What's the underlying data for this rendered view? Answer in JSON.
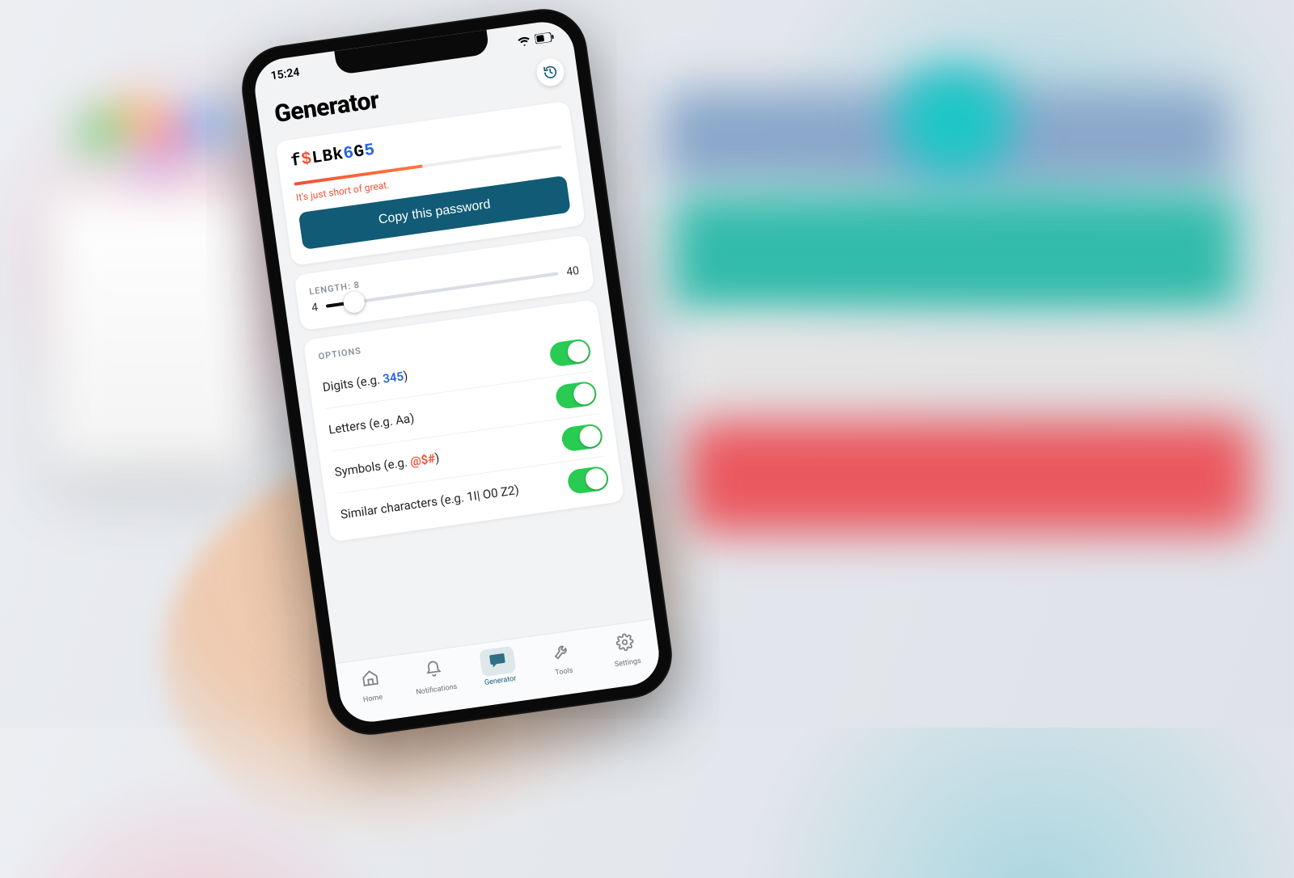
{
  "status": {
    "time": "15:24"
  },
  "page": {
    "title": "Generator"
  },
  "password": {
    "parts": [
      {
        "text": "f",
        "cls": ""
      },
      {
        "text": "$",
        "cls": "sym"
      },
      {
        "text": "LBk",
        "cls": ""
      },
      {
        "text": "6",
        "cls": "num"
      },
      {
        "text": "G",
        "cls": ""
      },
      {
        "text": "5",
        "cls": "num"
      }
    ],
    "strength_percent": 48,
    "strength_text": "It's just short of great.",
    "copy_label": "Copy this password"
  },
  "length": {
    "label": "LENGTH: 8",
    "min": "4",
    "max": "40",
    "value": 8,
    "percent": 12
  },
  "options": {
    "header": "OPTIONS",
    "items": [
      {
        "label": "Digits (e.g. ",
        "example": "345",
        "ex_class": "ex-num",
        "tail": ")",
        "on": true,
        "name": "digits"
      },
      {
        "label": "Letters (e.g. ",
        "example": "Aa",
        "ex_class": "",
        "tail": ")",
        "on": true,
        "name": "letters"
      },
      {
        "label": "Symbols (e.g. ",
        "example": "@$#",
        "ex_class": "ex-sym",
        "tail": ")",
        "on": true,
        "name": "symbols"
      },
      {
        "label": "Similar characters (e.g. ",
        "example": "1I| O0 Z2",
        "ex_class": "",
        "tail": ")",
        "on": true,
        "name": "similar"
      }
    ]
  },
  "tabs": [
    {
      "label": "Home",
      "icon": "home",
      "active": false
    },
    {
      "label": "Notifications",
      "icon": "bell",
      "active": false
    },
    {
      "label": "Generator",
      "icon": "chat",
      "active": true
    },
    {
      "label": "Tools",
      "icon": "wrench",
      "active": false
    },
    {
      "label": "Settings",
      "icon": "gear",
      "active": false
    }
  ],
  "colors": {
    "teal": "#175A72",
    "orange": "#e3553b",
    "green": "#34c759",
    "blue": "#2b63d8"
  }
}
